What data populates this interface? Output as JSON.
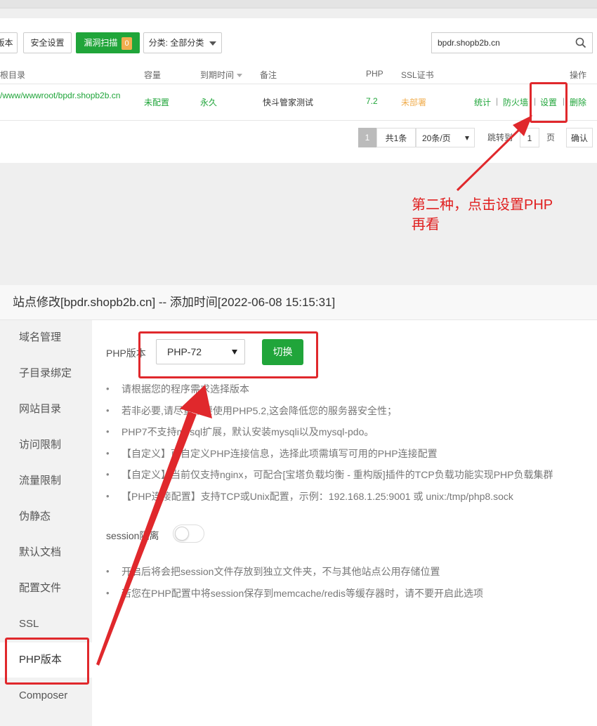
{
  "toolbar": {
    "version_btn": "版本",
    "security_btn": "安全设置",
    "scan_btn": "漏洞扫描",
    "scan_count": "0",
    "category_btn": "分类: 全部分类"
  },
  "search": {
    "value": "bpdr.shopb2b.cn"
  },
  "table": {
    "headers": {
      "root": "根目录",
      "capacity": "容量",
      "expiry": "到期时间",
      "remark": "备注",
      "php": "PHP",
      "ssl": "SSL证书",
      "ops": "操作"
    },
    "row": {
      "path": "/www/wwwroot/bpdr.shopb2b.cn",
      "capacity": "未配置",
      "expiry": "永久",
      "remark": "快斗管家测试",
      "php": "7.2",
      "ssl": "未部署",
      "op_stats": "统计",
      "op_firewall": "防火墙",
      "op_settings": "设置",
      "op_delete": "删除",
      "sep": "|"
    }
  },
  "pager": {
    "current": "1",
    "total": "共1条",
    "per_page": "20条/页",
    "jump_label": "跳转到",
    "jump_value": "1",
    "page_unit": "页",
    "confirm": "确认"
  },
  "annotation": {
    "line1": "第二种，点击设置PHP",
    "line2": "再看"
  },
  "dialog": {
    "title": "站点修改[bpdr.shopb2b.cn] -- 添加时间[2022-06-08 15:15:31]",
    "sidebar": [
      "域名管理",
      "子目录绑定",
      "网站目录",
      "访问限制",
      "流量限制",
      "伪静态",
      "默认文档",
      "配置文件",
      "SSL",
      "PHP版本",
      "Composer"
    ],
    "php_label": "PHP版本",
    "php_selected": "PHP-72",
    "switch_btn": "切换",
    "tips": [
      "请根据您的程序需求选择版本",
      "若非必要,请尽量不要使用PHP5.2,这会降低您的服务器安全性；",
      "PHP7不支持mysql扩展，默认安装mysqli以及mysql-pdo。",
      "【自定义】可自定义PHP连接信息，选择此项需填写可用的PHP连接配置",
      "【自定义】当前仅支持nginx，可配合[宝塔负载均衡 - 重构版]插件的TCP负载功能实现PHP负载集群",
      "【PHP连接配置】支持TCP或Unix配置，示例：192.168.1.25:9001 或 unix:/tmp/php8.sock"
    ],
    "session_label": "session隔离",
    "session_tips": [
      "开启后将会把session文件存放到独立文件夹，不与其他站点公用存储位置",
      "若您在PHP配置中将session保存到memcache/redis等缓存器时，请不要开启此选项"
    ]
  },
  "colors": {
    "brand_green": "#20a53a",
    "warning_orange": "#f0ad4e",
    "annotation_red": "#e02020"
  }
}
